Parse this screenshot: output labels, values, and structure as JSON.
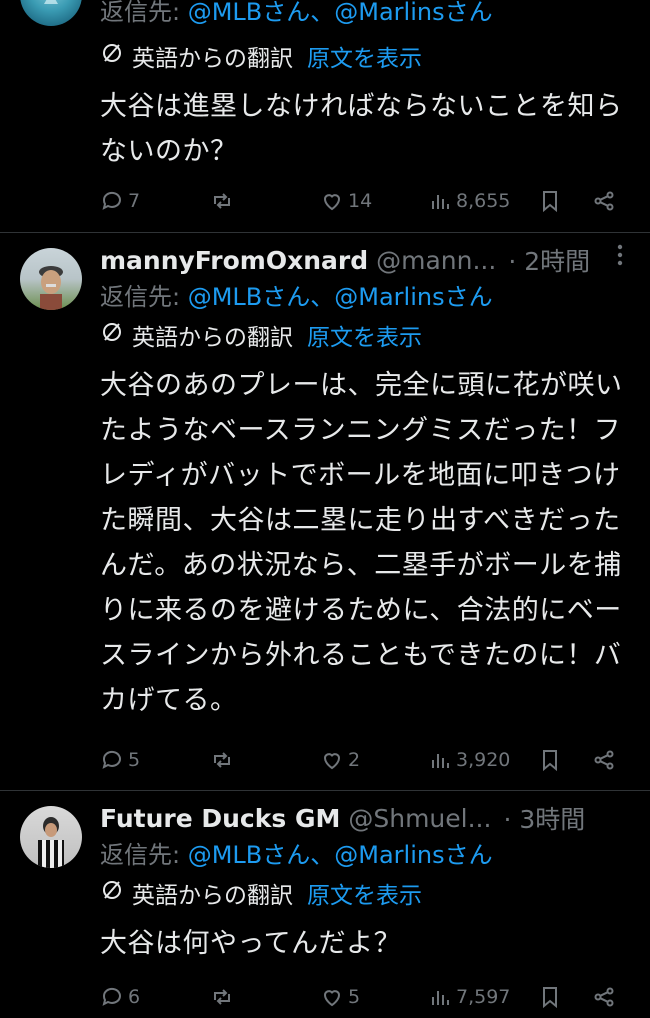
{
  "tweets": [
    {
      "reply_prefix": "返信先: ",
      "reply_targets": "@MLBさん、@Marlinsさん",
      "translation_label": "英語からの翻訳",
      "show_original": "原文を表示",
      "body": "大谷は進塁しなければならないことを知らないのか？",
      "replies": "7",
      "reposts": "",
      "likes": "14",
      "views": "8,655"
    },
    {
      "username": "mannyFromOxnard",
      "handle": "@mann...",
      "time": "· 2時間",
      "reply_prefix": "返信先: ",
      "reply_targets": "@MLBさん、@Marlinsさん",
      "translation_label": "英語からの翻訳",
      "show_original": "原文を表示",
      "body": "大谷のあのプレーは、完全に頭に花が咲いたようなベースランニングミスだった！フレディがバットでボールを地面に叩きつけた瞬間、大谷は二塁に走り出すべきだったんだ。あの状況なら、二塁手がボールを捕りに来るのを避けるために、合法的にベースラインから外れることもできたのに！バカげてる。",
      "replies": "5",
      "reposts": "",
      "likes": "2",
      "views": "3,920"
    },
    {
      "username": "Future Ducks GM",
      "handle": "@Shmuel...",
      "time": "· 3時間",
      "reply_prefix": "返信先: ",
      "reply_targets": "@MLBさん、@Marlinsさん",
      "translation_label": "英語からの翻訳",
      "show_original": "原文を表示",
      "body": "大谷は何やってんだよ？",
      "replies": "6",
      "reposts": "",
      "likes": "5",
      "views": "7,597"
    }
  ],
  "colors": {
    "background": "#000000",
    "text": "#e7e9ea",
    "secondary": "#71767b",
    "link": "#1d9bf0",
    "divider": "#2f3336"
  }
}
